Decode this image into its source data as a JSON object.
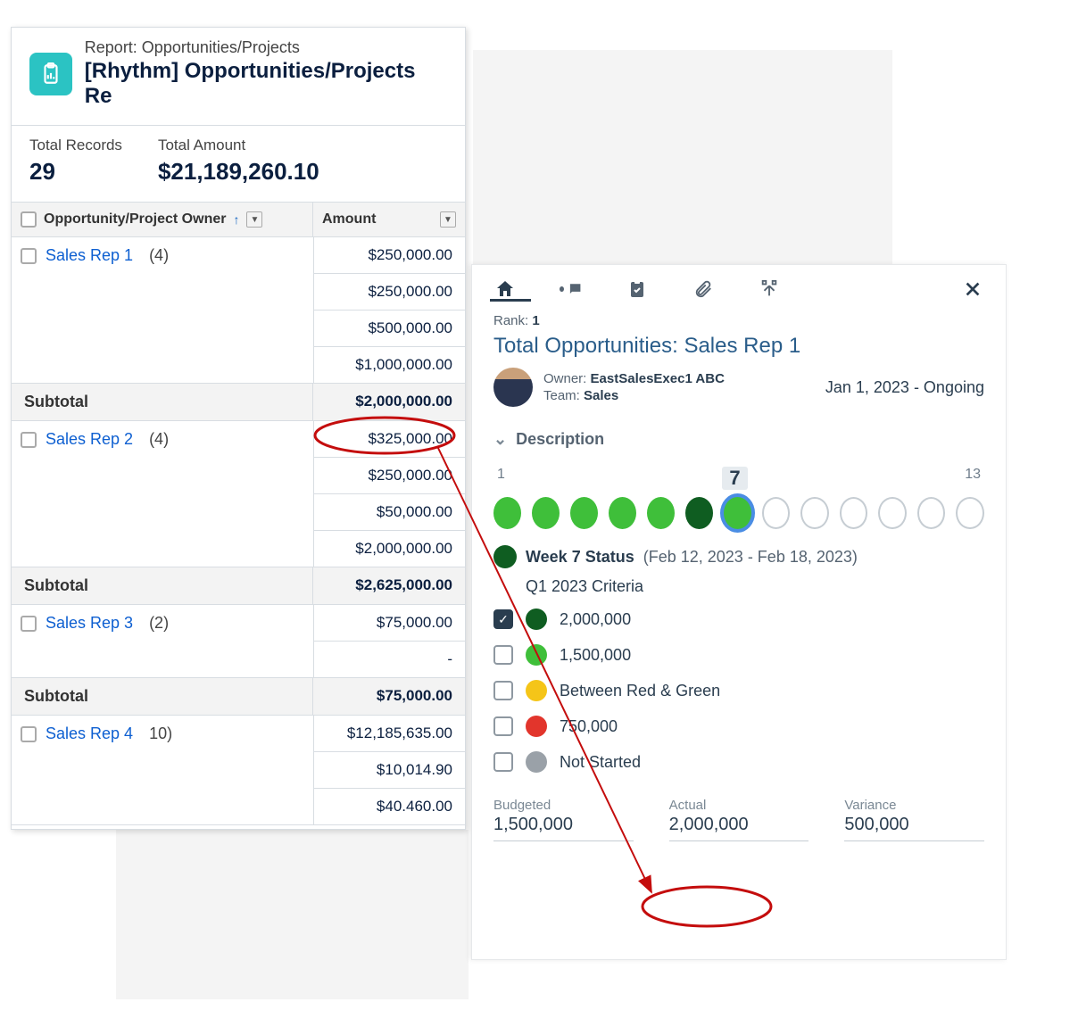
{
  "report": {
    "typeLabel": "Report: Opportunities/Projects",
    "name": "[Rhythm] Opportunities/Projects Re",
    "totals": {
      "recordsLabel": "Total Records",
      "recordsValue": "29",
      "amountLabel": "Total Amount",
      "amountValue": "$21,189,260.10"
    },
    "columns": {
      "ownerHeader": "Opportunity/Project Owner",
      "amountHeader": "Amount",
      "sortGlyph": "↑"
    },
    "subtotalLabel": "Subtotal",
    "groups": [
      {
        "name": "Sales Rep 1",
        "countDisplay": "(4)",
        "amounts": [
          "$250,000.00",
          "$250,000.00",
          "$500,000.00",
          "$1,000,000.00"
        ],
        "subtotal": "$2,000,000.00"
      },
      {
        "name": "Sales Rep 2",
        "countDisplay": "(4)",
        "amounts": [
          "$325,000.00",
          "$250,000.00",
          "$50,000.00",
          "$2,000,000.00"
        ],
        "subtotal": "$2,625,000.00"
      },
      {
        "name": "Sales Rep 3",
        "countDisplay": "(2)",
        "amounts": [
          "$75,000.00",
          "-"
        ],
        "subtotal": "$75,000.00"
      },
      {
        "name": "Sales Rep 4",
        "countDisplay": "10)",
        "amounts": [
          "$12,185,635.00",
          "$10,014.90",
          "$40.460.00"
        ],
        "subtotal": null
      }
    ]
  },
  "detail": {
    "rankLabel": "Rank:",
    "rankValue": "1",
    "title": "Total Opportunities: Sales Rep 1",
    "ownerLabel": "Owner:",
    "ownerValue": "EastSalesExec1 ABC",
    "teamLabel": "Team:",
    "teamValue": "Sales",
    "dateRange": "Jan 1, 2023 - Ongoing",
    "descriptionLabel": "Description",
    "scale": {
      "start": "1",
      "current": "7",
      "end": "13"
    },
    "statusTitle": "Week 7 Status",
    "statusRange": "(Feb 12, 2023 - Feb 18, 2023)",
    "criteriaTitle": "Q1 2023 Criteria",
    "criteria": [
      {
        "label": "2,000,000",
        "color": "c-dark",
        "checked": true
      },
      {
        "label": "1,500,000",
        "color": "c-green",
        "checked": false
      },
      {
        "label": "Between Red & Green",
        "color": "c-yellow",
        "checked": false
      },
      {
        "label": "750,000",
        "color": "c-red",
        "checked": false
      },
      {
        "label": "Not Started",
        "color": "c-gray",
        "checked": false
      }
    ],
    "bva": {
      "budgetedLabel": "Budgeted",
      "budgetedValue": "1,500,000",
      "actualLabel": "Actual",
      "actualValue": "2,000,000",
      "varianceLabel": "Variance",
      "varianceValue": "500,000"
    }
  }
}
